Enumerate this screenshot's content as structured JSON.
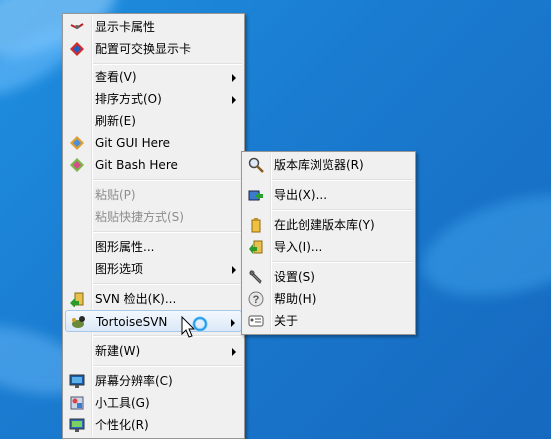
{
  "main_menu": {
    "items": [
      {
        "label": "显示卡属性",
        "icon": "display-card-icon"
      },
      {
        "label": "配置可交换显示卡",
        "icon": "switchable-graphics-icon"
      },
      {
        "label": "查看(V)",
        "icon": ""
      },
      {
        "label": "排序方式(O)",
        "icon": ""
      },
      {
        "label": "刷新(E)",
        "icon": ""
      },
      {
        "label": "Git GUI Here",
        "icon": "git-gui-icon"
      },
      {
        "label": "Git Bash Here",
        "icon": "git-bash-icon"
      },
      {
        "label": "粘贴(P)",
        "icon": ""
      },
      {
        "label": "粘贴快捷方式(S)",
        "icon": ""
      },
      {
        "label": "图形属性...",
        "icon": ""
      },
      {
        "label": "图形选项",
        "icon": ""
      },
      {
        "label": "SVN 检出(K)...",
        "icon": "svn-checkout-icon"
      },
      {
        "label": "TortoiseSVN",
        "icon": "tortoisesvn-icon"
      },
      {
        "label": "新建(W)",
        "icon": ""
      },
      {
        "label": "屏幕分辨率(C)",
        "icon": "screen-resolution-icon"
      },
      {
        "label": "小工具(G)",
        "icon": "gadgets-icon"
      },
      {
        "label": "个性化(R)",
        "icon": "personalize-icon"
      }
    ]
  },
  "sub_menu": {
    "items": [
      {
        "label": "版本库浏览器(R)",
        "icon": "repo-browser-icon"
      },
      {
        "label": "导出(X)...",
        "icon": "export-icon"
      },
      {
        "label": "在此创建版本库(Y)",
        "icon": "create-repo-icon"
      },
      {
        "label": "导入(I)...",
        "icon": "import-icon"
      },
      {
        "label": "设置(S)",
        "icon": "settings-icon"
      },
      {
        "label": "帮助(H)",
        "icon": "help-icon"
      },
      {
        "label": "关于",
        "icon": "about-icon"
      }
    ]
  },
  "colors": {
    "desktop": "#1a7cd0",
    "menu_bg": "#f0f0f0",
    "hover_border": "#a8c8ea",
    "disabled_text": "#8d8d8d"
  }
}
